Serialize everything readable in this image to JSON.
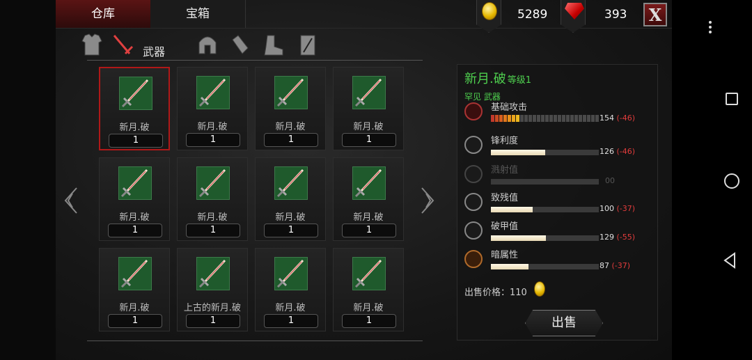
{
  "tabs": [
    {
      "label": "仓库",
      "active": true
    },
    {
      "label": "宝箱",
      "active": false
    }
  ],
  "currency": {
    "gold": "5289",
    "gems": "393",
    "close_label": "X",
    "gold_icon": "gold-coin-icon",
    "gem_icon": "red-gem-icon"
  },
  "categories": {
    "active_label": "武器",
    "icons": [
      "armor-icon",
      "sword-icon",
      "helmet-icon",
      "bracer-icon",
      "boot-icon",
      "card-icon"
    ]
  },
  "grid": {
    "items": [
      {
        "name": "新月.破",
        "qty": "1",
        "selected": true
      },
      {
        "name": "新月.破",
        "qty": "1"
      },
      {
        "name": "新月.破",
        "qty": "1"
      },
      {
        "name": "新月.破",
        "qty": "1"
      },
      {
        "name": "新月.破",
        "qty": "1"
      },
      {
        "name": "新月.破",
        "qty": "1"
      },
      {
        "name": "新月.破",
        "qty": "1"
      },
      {
        "name": "新月.破",
        "qty": "1"
      },
      {
        "name": "新月.破",
        "qty": "1"
      },
      {
        "name": "上古的新月.破",
        "qty": "1"
      },
      {
        "name": "新月.破",
        "qty": "1"
      },
      {
        "name": "新月.破",
        "qty": "1"
      }
    ]
  },
  "detail": {
    "name": "新月.破",
    "level": "等级1",
    "rarity": "罕见 武器",
    "stats": [
      {
        "label": "基础攻击",
        "value": "154",
        "diff": "(-46)",
        "type": "segmented",
        "fill": 0.27,
        "icon": "attack-icon"
      },
      {
        "label": "锋利度",
        "value": "126",
        "diff": "(-46)",
        "fill": 0.5,
        "icon": "sharpness-icon"
      },
      {
        "label": "溅射值",
        "value": "00",
        "diff": "",
        "fill": 0.0,
        "dim": true,
        "icon": "splash-icon"
      },
      {
        "label": "致残值",
        "value": "100",
        "diff": "(-37)",
        "fill": 0.39,
        "icon": "cripple-icon"
      },
      {
        "label": "破甲值",
        "value": "129",
        "diff": "(-55)",
        "fill": 0.51,
        "icon": "armor-break-icon"
      },
      {
        "label": "暗属性",
        "value": "87",
        "diff": "(-37)",
        "fill": 0.35,
        "icon": "dark-element-icon"
      }
    ],
    "sell_price_label": "出售价格：",
    "sell_price": "110",
    "sell_button": "出售"
  }
}
